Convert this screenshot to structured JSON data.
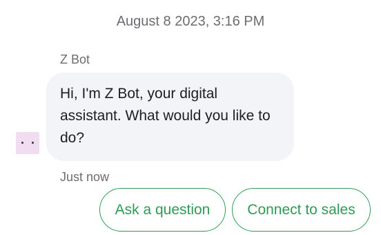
{
  "timestamp": "August 8 2023, 3:16 PM",
  "bot": {
    "name": "Z Bot",
    "message": "Hi, I'm Z Bot, your digital assistant. What would you like to do?",
    "message_time": "Just now"
  },
  "quick_replies": {
    "ask": "Ask a question",
    "sales": "Connect to sales"
  },
  "colors": {
    "accent": "#2e9b55",
    "bubble_bg": "#f2f4f7",
    "avatar_bg": "#f1ddf2"
  },
  "icons": {
    "avatar": "bot-avatar-icon"
  }
}
